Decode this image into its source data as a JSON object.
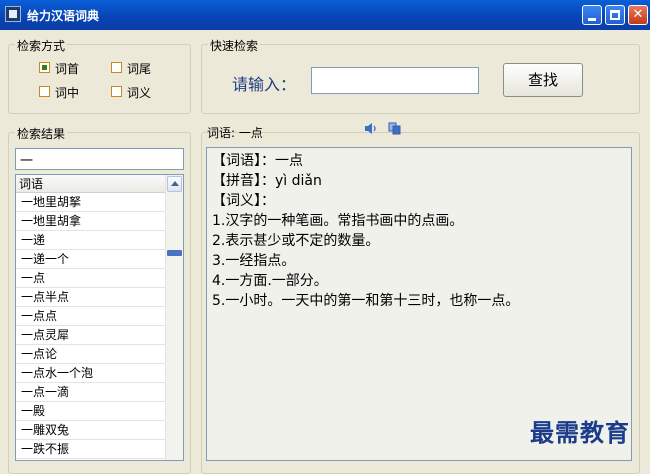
{
  "window": {
    "title": "给力汉语词典"
  },
  "search_mode": {
    "label": "检索方式",
    "options": [
      {
        "label": "词首",
        "checked": true
      },
      {
        "label": "词尾",
        "checked": false
      },
      {
        "label": "词中",
        "checked": false
      },
      {
        "label": "词义",
        "checked": false
      }
    ]
  },
  "quick_search": {
    "label": "快速检索",
    "prompt": "请输入：",
    "input_value": "",
    "button_label": "查找"
  },
  "results": {
    "label": "检索结果",
    "filter_value": "一",
    "column_header": "词语",
    "items": [
      "一地里胡拏",
      "一地里胡拿",
      "一递",
      "一递一个",
      "一点",
      "一点半点",
      "一点点",
      "一点灵犀",
      "一点论",
      "一点水一个泡",
      "一点一滴",
      "一殿",
      "一雕双兔",
      "一跌不振"
    ]
  },
  "detail": {
    "heading": "词语: 一点",
    "lines": [
      "【词语】：一点",
      "【拼音】：yì diǎn",
      "【词义】：",
      "1.汉字的一种笔画。常指书画中的点画。",
      "2.表示甚少或不定的数量。",
      "3.一经指点。",
      "4.一方面.一部分。",
      "5.一小时。一天中的第一和第十三时，也称一点。"
    ]
  },
  "watermark": "最需教育"
}
